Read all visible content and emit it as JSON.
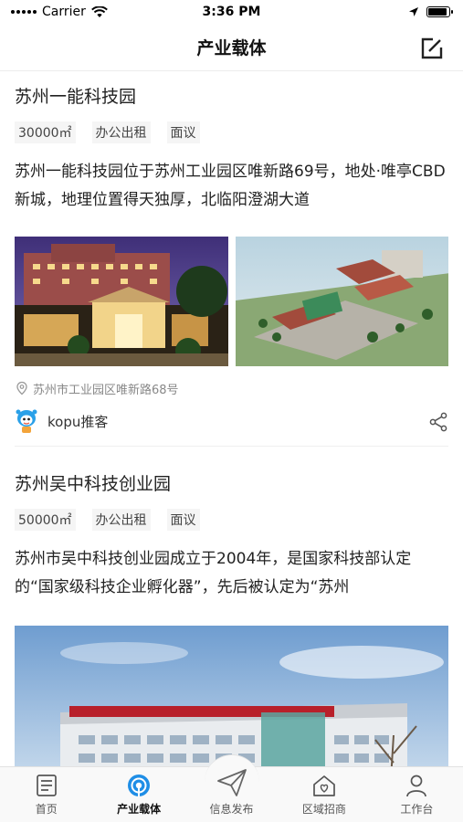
{
  "status_bar": {
    "carrier": "Carrier",
    "time": "3:36 PM",
    "battery_level": 0.9
  },
  "nav": {
    "title": "产业载体",
    "edit_icon": "edit-icon"
  },
  "listings": [
    {
      "title": "苏州一能科技园",
      "tags": [
        "30000㎡",
        "办公出租",
        "面议"
      ],
      "description": "苏州一能科技园位于苏州工业园区唯新路69号，地处·唯亭CBD新城，地理位置得天独厚，北临阳澄湖大道",
      "address": "苏州市工业园区唯新路68号",
      "author": "kopu推客"
    },
    {
      "title": "苏州吴中科技创业园",
      "tags": [
        "50000㎡",
        "办公出租",
        "面议"
      ],
      "description": "苏州市吴中科技创业园成立于2004年，是国家科技部认定的“国家级科技企业孵化器”，先后被认定为“苏州"
    }
  ],
  "tabs": [
    {
      "label": "首页",
      "icon": "home-list-icon",
      "active": false
    },
    {
      "label": "产业载体",
      "icon": "carrier-icon",
      "active": true
    },
    {
      "label": "信息发布",
      "icon": "send-icon",
      "active": false
    },
    {
      "label": "区域招商",
      "icon": "house-heart-icon",
      "active": false
    },
    {
      "label": "工作台",
      "icon": "user-icon",
      "active": false
    }
  ],
  "colors": {
    "accent": "#1f8ee6",
    "text": "#222222",
    "muted": "#888888",
    "tag_bg": "#f5f5f5"
  }
}
